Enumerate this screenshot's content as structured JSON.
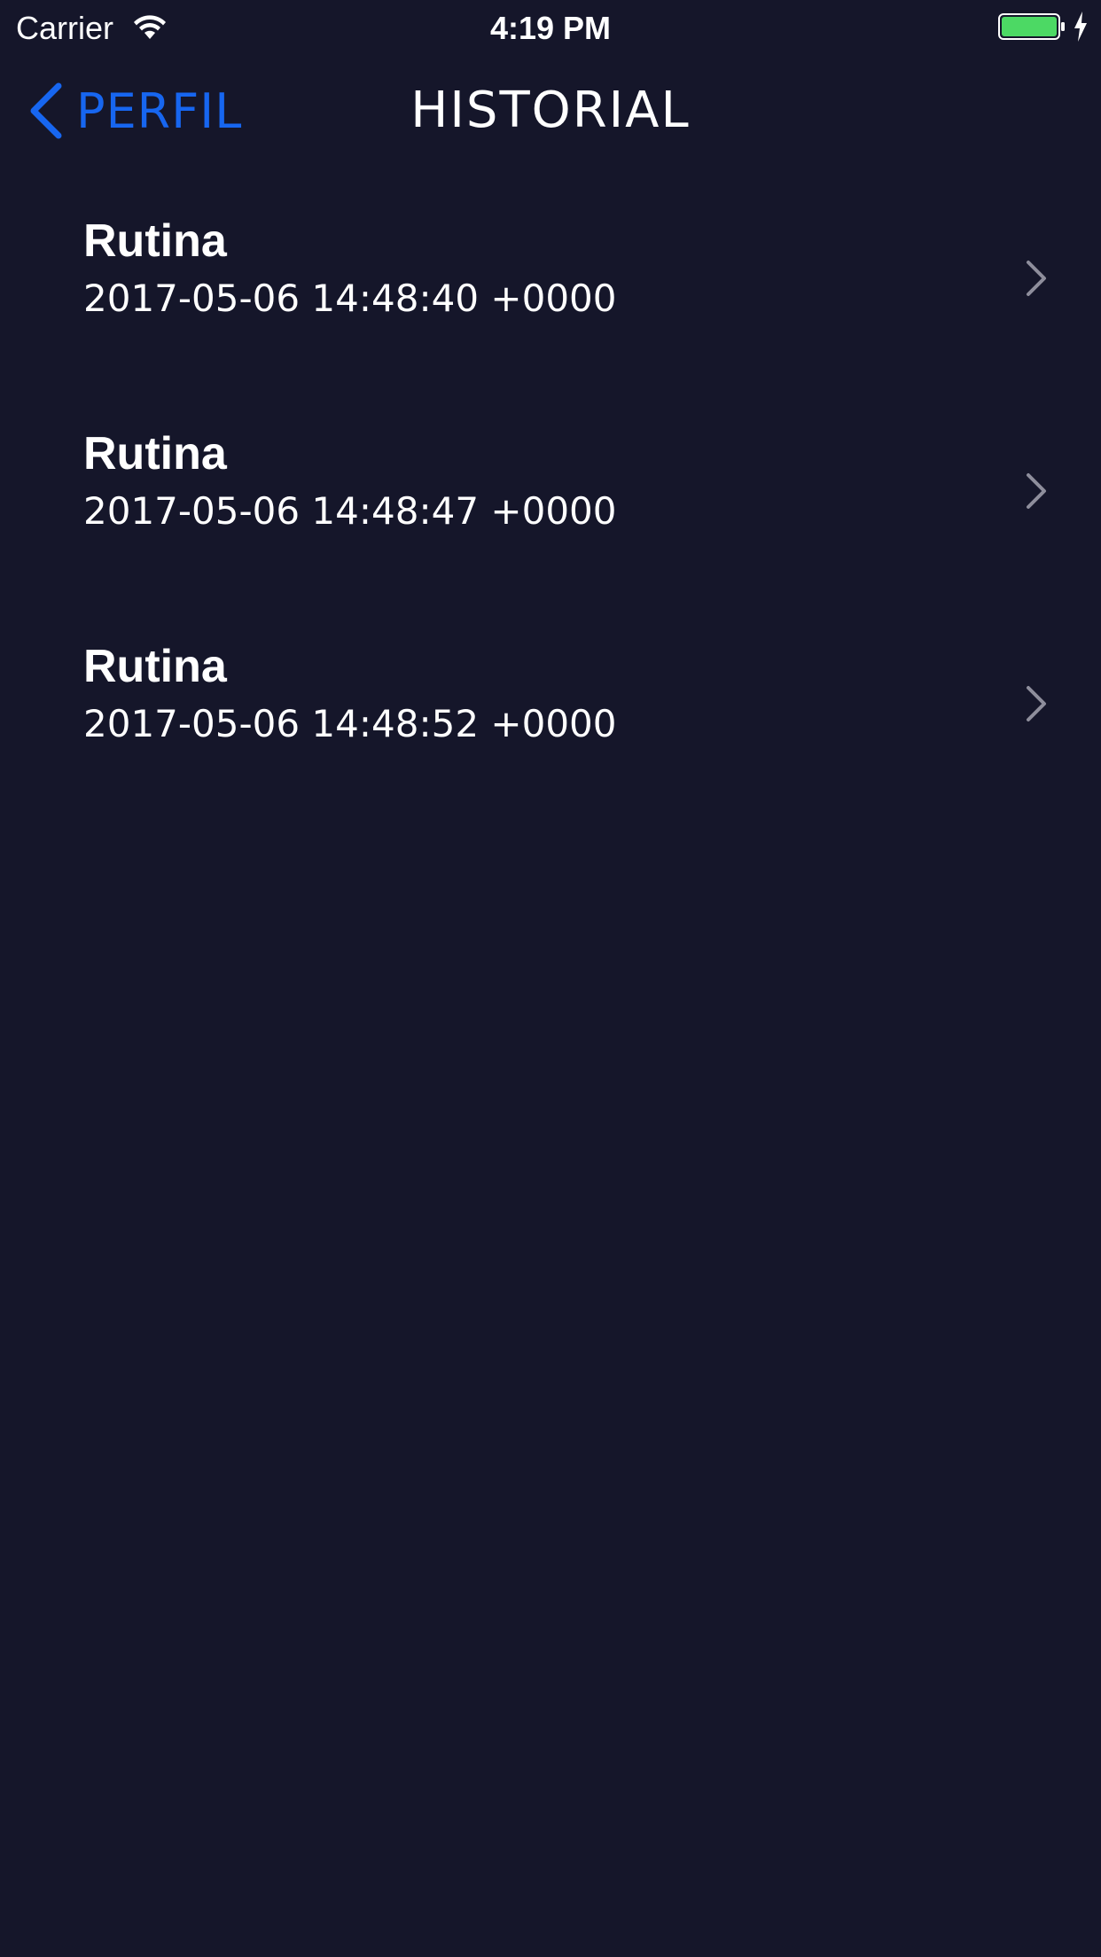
{
  "status_bar": {
    "carrier": "Carrier",
    "time": "4:19 PM",
    "battery_color": "#4cd964"
  },
  "nav": {
    "back_label": "PERFIL",
    "title": "HISTORIAL",
    "accent_color": "#1766f0"
  },
  "history": {
    "items": [
      {
        "title": "Rutina",
        "date": "2017-05-06 14:48:40 +0000"
      },
      {
        "title": "Rutina",
        "date": "2017-05-06 14:48:47 +0000"
      },
      {
        "title": "Rutina",
        "date": "2017-05-06 14:48:52 +0000"
      }
    ]
  }
}
